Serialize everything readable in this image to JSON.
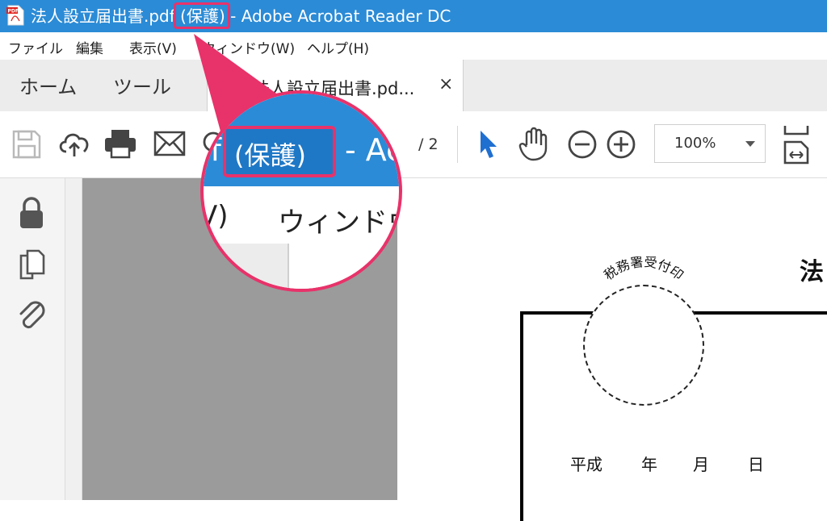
{
  "titlebar": {
    "title_main": "法人設立届出書.pdf",
    "title_protected": "(保護)",
    "title_rest": "- Adobe Acrobat Reader DC",
    "bg_color": "#2b8bd6",
    "highlight_color": "#e8326a"
  },
  "menubar": {
    "items": [
      "ファイル",
      "編集",
      "表示(V)",
      "ウィンドウ(W)",
      "ヘルプ(H)"
    ]
  },
  "tabs": {
    "home": "ホーム",
    "tools": "ツール",
    "document": "法人設立届出書.pd...",
    "close_glyph": "×"
  },
  "toolbar": {
    "icons": [
      "save-icon",
      "cloud-upload-icon",
      "print-icon",
      "mail-icon",
      "search-icon",
      "select-pointer-icon",
      "hand-icon",
      "zoom-out-icon",
      "zoom-in-icon",
      "fit-page-icon"
    ],
    "page_total": "/ 2",
    "zoom": "100%"
  },
  "leftrail": {
    "icons": [
      "lock-icon",
      "pages-icon",
      "attachment-icon"
    ]
  },
  "document": {
    "title_char": "法",
    "stamp_label": "税務署受付印",
    "date_labels": [
      "平成",
      "年",
      "月",
      "日"
    ]
  },
  "magnifier": {
    "title_left": "lf",
    "title_protected": "(保護)",
    "title_right": "- Ac",
    "menu_left": "V)",
    "menu_right": "ウィンドウ"
  }
}
